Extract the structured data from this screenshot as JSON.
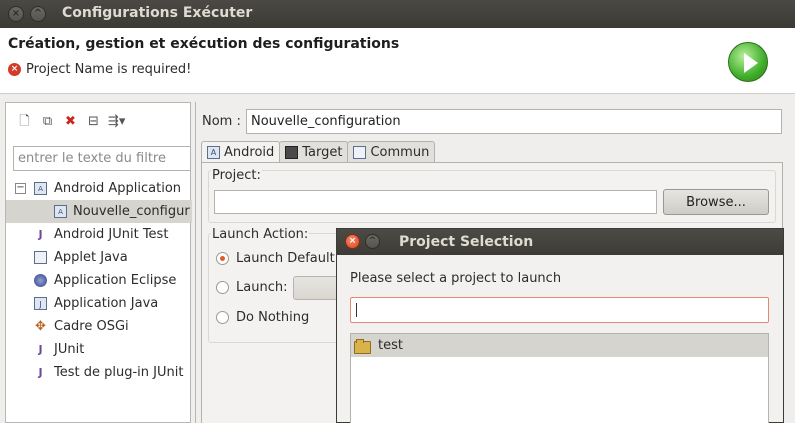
{
  "window": {
    "title": "Configurations Exécuter"
  },
  "header": {
    "title": "Création, gestion et exécution des configurations",
    "error": "Project Name is required!"
  },
  "left_panel": {
    "toolbar_icons": [
      "new-config-icon",
      "duplicate-icon",
      "delete-icon",
      "collapse-all-icon",
      "filter-icon"
    ],
    "filter_placeholder": "entrer le texte du filtre",
    "tree": [
      {
        "label": "Android Application",
        "icon": "android-app-icon",
        "expanded": true
      },
      {
        "label": "Nouvelle_configur",
        "icon": "android-config-icon",
        "selected": true,
        "child": true
      },
      {
        "label": "Android JUnit Test",
        "icon": "junit-icon"
      },
      {
        "label": "Applet Java",
        "icon": "applet-icon"
      },
      {
        "label": "Application Eclipse",
        "icon": "eclipse-icon"
      },
      {
        "label": "Application Java",
        "icon": "java-app-icon"
      },
      {
        "label": "Cadre OSGi",
        "icon": "osgi-icon"
      },
      {
        "label": "JUnit",
        "icon": "junit-icon"
      },
      {
        "label": "Test de plug-in JUnit",
        "icon": "junit-plugin-icon"
      }
    ]
  },
  "config": {
    "name_label": "Nom :",
    "name_value": "Nouvelle_configuration",
    "tabs": [
      {
        "label": "Android",
        "active": true
      },
      {
        "label": "Target"
      },
      {
        "label": "Commun"
      }
    ],
    "project_label": "Project:",
    "project_value": "",
    "browse_label": "Browse...",
    "launch_action_label": "Launch Action:",
    "launch_options": [
      {
        "label": "Launch Default",
        "selected": true
      },
      {
        "label": "Launch:"
      },
      {
        "label": "Do Nothing"
      }
    ]
  },
  "dialog": {
    "title": "Project Selection",
    "message": "Please select a project to launch",
    "search_value": "",
    "items": [
      {
        "label": "test",
        "selected": true
      }
    ]
  },
  "colors": {
    "titlebar": "#3c3b37",
    "error": "#d33a2a",
    "run_green": "#3fae2a",
    "radio_selected": "#e45a2c"
  }
}
